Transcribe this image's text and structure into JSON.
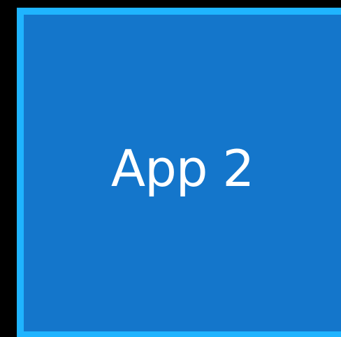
{
  "app_tile": {
    "label": "App 2",
    "state": "focused",
    "colors": {
      "background": "#1476cb",
      "focus_border": "#1fb4ff",
      "label": "#ffffff",
      "screen_background": "#000000"
    }
  }
}
